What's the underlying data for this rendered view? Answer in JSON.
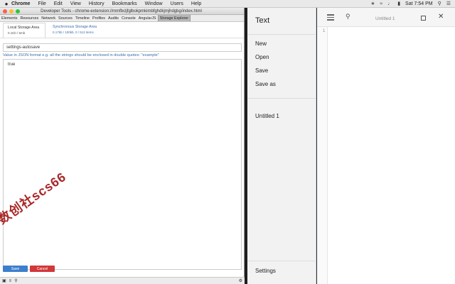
{
  "menubar": {
    "apple": "",
    "items": [
      "Chrome",
      "File",
      "Edit",
      "View",
      "History",
      "Bookmarks",
      "Window",
      "Users",
      "Help"
    ],
    "clock": "Sat 7:54 PM"
  },
  "devtools": {
    "window_title": "Developer Tools - chrome-extension://mmfbcljfglbokpmkimbfghdkjmjhdgbg/index.html",
    "tabs": [
      "Elements",
      "Resources",
      "Network",
      "Sources",
      "Timeline",
      "Profiles",
      "Audits",
      "Console",
      "AngularJS",
      "Storage Explorer"
    ],
    "storage_tabs": [
      {
        "label": "Local Storage Area",
        "sub": "0.1Kb / 5mb"
      },
      {
        "label": "Synchronous Storage Area",
        "sub": "0.17kb / 100kb, 0 / 512 items"
      }
    ],
    "key_value": "settings-autosave",
    "hint": "Value in JSON format e.g. all the strings should be enclosed in double quotes: \"example\"",
    "value_text": "true",
    "save_label": "Save",
    "cancel_label": "Cancel"
  },
  "watermark": "数创社scs66",
  "text_app": {
    "app_title": "Text",
    "menu": [
      "New",
      "Open",
      "Save",
      "Save as"
    ],
    "open_files": [
      "Untitled 1"
    ],
    "settings_label": "Settings",
    "doc_title": "Untitled 1",
    "line_number": "1"
  },
  "colors": {
    "save_button": "#3c7fcc",
    "cancel_button": "#d2373a",
    "link_blue": "#3b6fa8"
  }
}
